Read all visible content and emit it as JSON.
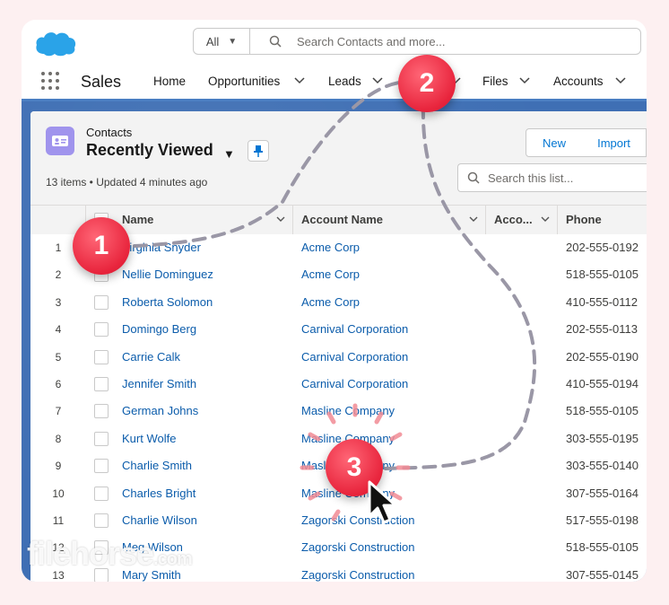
{
  "header": {
    "search_scope": "All",
    "search_placeholder": "Search Contacts and more..."
  },
  "nav": {
    "app_name": "Sales",
    "items": [
      {
        "label": "Home"
      },
      {
        "label": "Opportunities"
      },
      {
        "label": "Leads"
      },
      {
        "label": "Files"
      },
      {
        "label": "Accounts"
      }
    ]
  },
  "list": {
    "object_label": "Contacts",
    "view_name": "Recently Viewed",
    "meta": "13 items • Updated 4 minutes ago",
    "new_button": "New",
    "import_button": "Import",
    "search_placeholder": "Search this list...",
    "columns": [
      "Name",
      "Account Name",
      "Acco...",
      "Phone"
    ],
    "rows": [
      {
        "num": "1",
        "name": "Virginia Snyder",
        "account": "Acme Corp",
        "phone": "202-555-0192"
      },
      {
        "num": "2",
        "name": "Nellie Dominguez",
        "account": "Acme Corp",
        "phone": "518-555-0105"
      },
      {
        "num": "3",
        "name": "Roberta Solomon",
        "account": "Acme Corp",
        "phone": "410-555-0112"
      },
      {
        "num": "4",
        "name": "Domingo Berg",
        "account": "Carnival Corporation",
        "phone": "202-555-0113"
      },
      {
        "num": "5",
        "name": "Carrie Calk",
        "account": "Carnival Corporation",
        "phone": "202-555-0190"
      },
      {
        "num": "6",
        "name": "Jennifer Smith",
        "account": "Carnival Corporation",
        "phone": "410-555-0194"
      },
      {
        "num": "7",
        "name": "German Johns",
        "account": "Masline Company",
        "phone": "518-555-0105"
      },
      {
        "num": "8",
        "name": "Kurt Wolfe",
        "account": "Masline Company",
        "phone": "303-555-0195"
      },
      {
        "num": "9",
        "name": "Charlie Smith",
        "account": "Masline Company",
        "phone": "303-555-0140"
      },
      {
        "num": "10",
        "name": "Charles Bright",
        "account": "Masline Company",
        "phone": "307-555-0164"
      },
      {
        "num": "11",
        "name": "Charlie Wilson",
        "account": "Zagorski Construction",
        "phone": "517-555-0198"
      },
      {
        "num": "12",
        "name": "Meg Wilson",
        "account": "Zagorski Construction",
        "phone": "518-555-0105"
      },
      {
        "num": "13",
        "name": "Mary Smith",
        "account": "Zagorski Construction",
        "phone": "307-555-0145"
      }
    ]
  },
  "overlay": {
    "step_badges": [
      "1",
      "2",
      "3"
    ],
    "watermark": "filehorse",
    "watermark_suffix": ".com"
  },
  "colors": {
    "accent_blue": "#0176d3",
    "link_blue": "#0b5cab",
    "brand_band": "#3f6fb4",
    "object_icon": "#a094ed",
    "badge_red": "#e8243c",
    "page_bg": "#fdf0f1"
  }
}
